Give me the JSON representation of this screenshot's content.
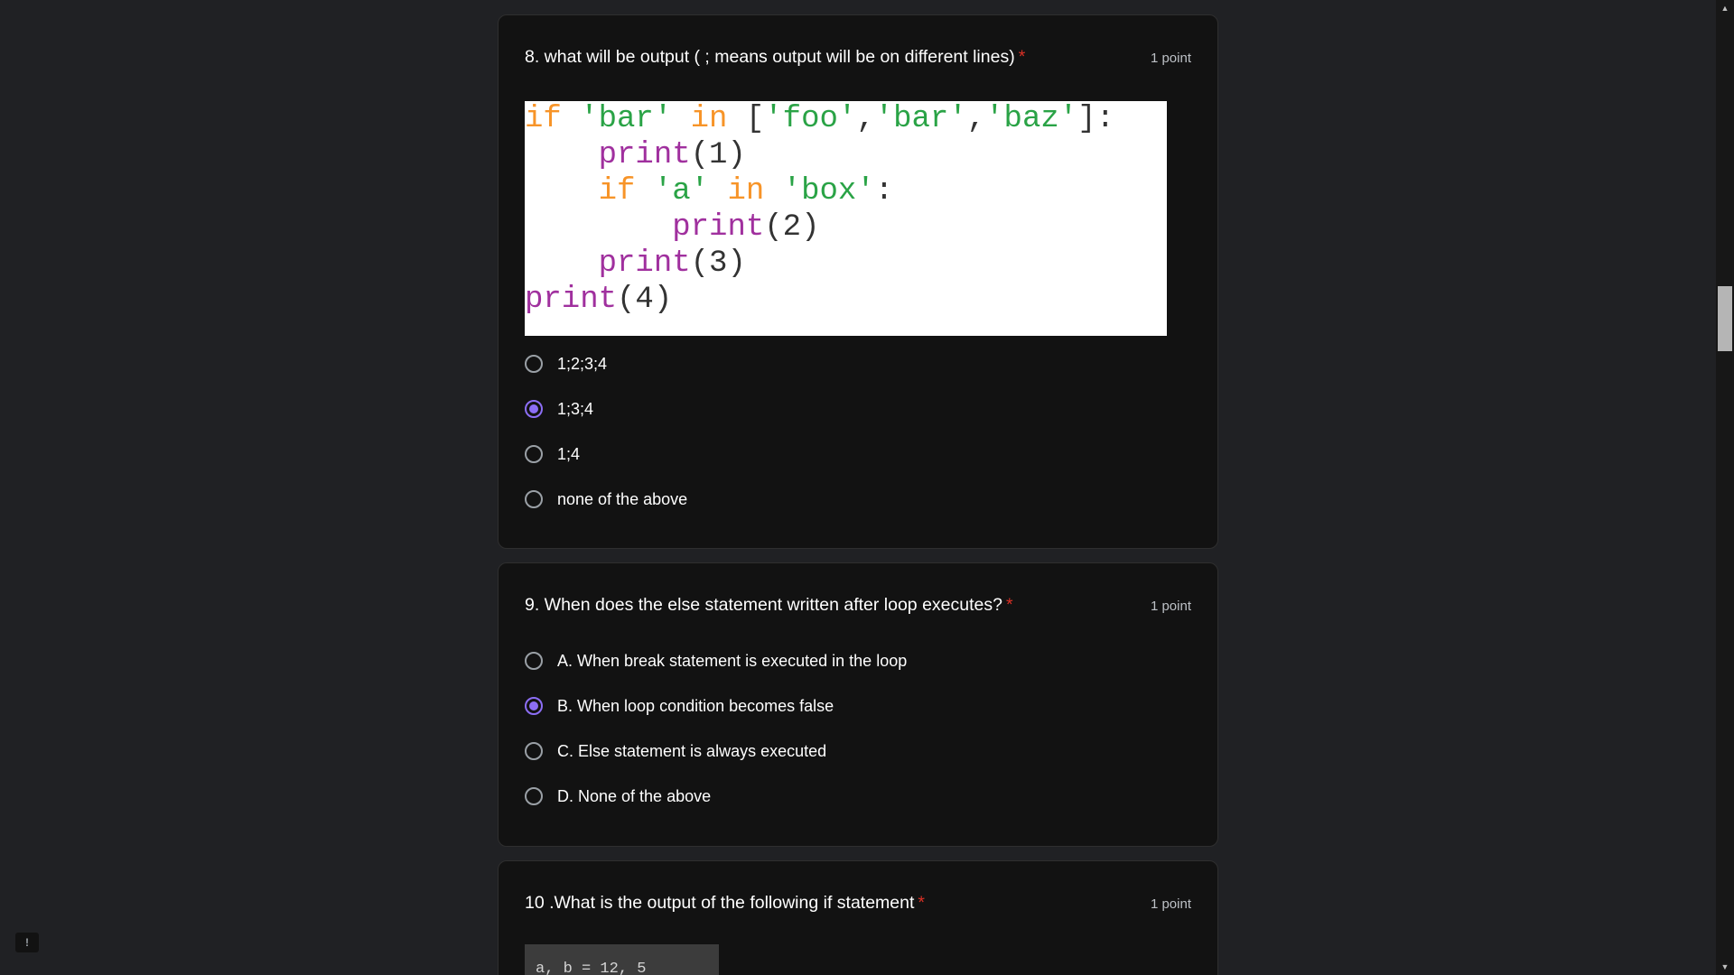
{
  "questions": [
    {
      "title": "8. what will be output ( ; means output will be on different lines)",
      "required_mark": "*",
      "points": "1 point",
      "code_image_lines": [
        "if 'bar' in ['foo','bar','baz']:",
        "    print(1)",
        "    if 'a' in 'box':",
        "        print(2)",
        "    print(3)",
        "print(4)"
      ],
      "options": [
        "1;2;3;4",
        "1;3;4",
        "1;4",
        "none of the above"
      ],
      "selected_option": "1;3;4"
    },
    {
      "title": "9. When does the else statement written after loop executes?",
      "required_mark": "*",
      "points": "1 point",
      "options": [
        "A. When break statement is executed in the loop",
        "B. When loop condition becomes false",
        "C. Else statement is always executed",
        "D. None of the above"
      ],
      "selected_option": "B. When loop condition becomes false"
    },
    {
      "title": "10 .What is the output of the following if statement",
      "required_mark": "*",
      "points": "1 point",
      "code_image_partial": "a, b = 12, 5"
    }
  ],
  "icons": {
    "radio_selected_color": "#8c6ef5",
    "required_color": "#d93025",
    "feedback": "report-problem-icon",
    "scroll_up": "scroll-up-arrow-icon",
    "scroll_down": "scroll-down-arrow-icon"
  }
}
